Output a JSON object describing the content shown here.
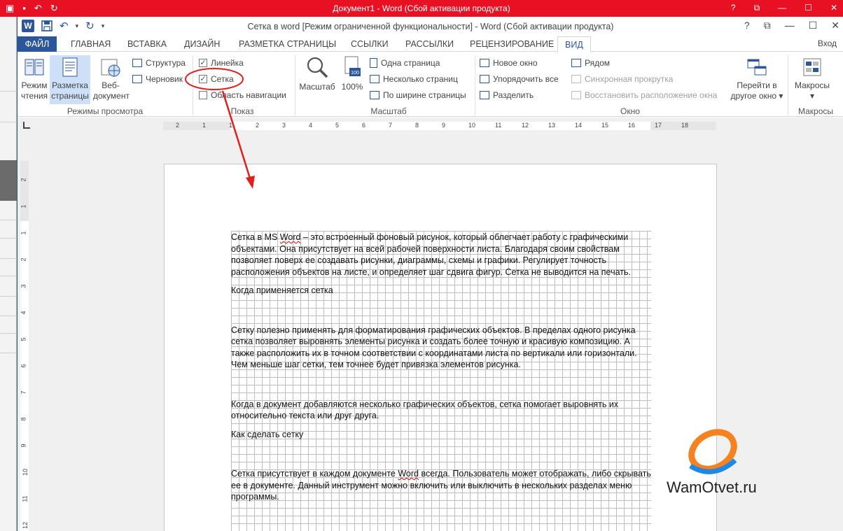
{
  "back_window": {
    "title": "Документ1 - Word (Сбой активации продукта)"
  },
  "window": {
    "title": "Сетка в word [Режим ограниченной функциональности] - Word (Сбой активации продукта)",
    "controls": {
      "help": "?",
      "restore_ribbon": "⧉",
      "minimize": "—",
      "maximize": "☐",
      "close": "✕"
    }
  },
  "tabs": {
    "file": "ФАЙЛ",
    "home": "ГЛАВНАЯ",
    "insert": "ВСТАВКА",
    "design": "ДИЗАЙН",
    "layout": "РАЗМЕТКА СТРАНИЦЫ",
    "references": "ССЫЛКИ",
    "mailings": "РАССЫЛКИ",
    "review": "РЕЦЕНЗИРОВАНИЕ",
    "view": "ВИД",
    "login": "Вход"
  },
  "ribbon": {
    "views": {
      "label": "Режимы просмотра",
      "read_mode": [
        "Режим",
        "чтения"
      ],
      "print_layout": [
        "Разметка",
        "страницы"
      ],
      "web_layout": [
        "Веб-",
        "документ"
      ],
      "outline": "Структура",
      "draft": "Черновик"
    },
    "show": {
      "label": "Показ",
      "ruler": "Линейка",
      "gridlines": "Сетка",
      "nav_pane": "Область навигации",
      "ruler_checked": true,
      "gridlines_checked": true,
      "nav_pane_checked": false
    },
    "zoom": {
      "label": "Масштаб",
      "zoom": "Масштаб",
      "hundred": "100%",
      "one_page": "Одна страница",
      "multiple_pages": "Несколько страниц",
      "page_width": "По ширине страницы"
    },
    "window": {
      "label": "Окно",
      "new_window": "Новое окно",
      "arrange_all": "Упорядочить все",
      "split": "Разделить",
      "side_by_side": "Рядом",
      "sync_scroll": "Синхронная прокрутка",
      "reset_position": "Восстановить расположение окна",
      "switch_windows": [
        "Перейти в",
        "другое окно ▾"
      ]
    },
    "macros": {
      "label": "Макросы",
      "macros": "Макросы",
      "dropdown": "▾"
    }
  },
  "ruler": {
    "h_ticks": [
      "2",
      "1",
      "1",
      "2",
      "3",
      "4",
      "5",
      "6",
      "7",
      "8",
      "9",
      "10",
      "11",
      "12",
      "13",
      "14",
      "15",
      "16",
      "17",
      "18"
    ],
    "v_ticks": [
      "2",
      "1",
      "1",
      "2",
      "3",
      "4",
      "5",
      "6",
      "7",
      "8",
      "9",
      "10",
      "11",
      "12"
    ]
  },
  "document": {
    "p1_a": "Сетка в MS ",
    "p1_word": "Word",
    "p1_b": " – это встроенный фоновый рисунок, который облегчает работу с графическими объектами. Она присутствует на всей рабочей поверхности листа. Благодаря своим свойствам позволяет поверх ее создавать рисунки, диаграммы, схемы и графики. Регулирует точность расположения объектов на листе, и определяет шаг сдвига фигур. Сетка не выводится на печать.",
    "h1": "Когда применяется сетка",
    "p2": "Сетку полезно применять для форматирования графических объектов. В пределах одного рисунка сетка позволяет выровнять элементы рисунка и создать более точную и красивую композицию. А также расположить их в точном соответствии с координатами листа по вертикали или горизонтали. Чем меньше шаг сетки, тем точнее будет привязка элементов рисунка.",
    "p3": "Когда в документ добавляются несколько графических объектов, сетка помогает выровнять их относительно текста или друг друга.",
    "h2": "Как сделать сетку",
    "p4_a": "Сетка присутствует в каждом документе ",
    "p4_word": "Word",
    "p4_b": " всегда. Пользователь может отображать, либо скрывать ее в документе. Данный инструмент можно включить или выключить в нескольких разделах меню программы."
  },
  "watermark": {
    "text": "WamOtvet.ru",
    "orange": "#f58220",
    "blue": "#1e88e5"
  },
  "colors": {
    "accent": "#2b579a",
    "titlebar_back": "#e81123",
    "callout": "#e0201b"
  }
}
